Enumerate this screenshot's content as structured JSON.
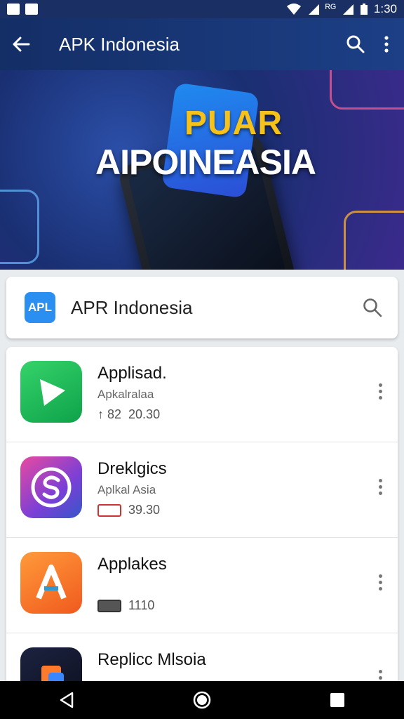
{
  "status_bar": {
    "time": "1:30",
    "signal": "ᴿᴳ"
  },
  "app_bar": {
    "title": "APK Indonesia"
  },
  "banner": {
    "line1": "PUAR",
    "line2": "AIPOINEASIA"
  },
  "search": {
    "logo_text": "APL",
    "query": "APR Indonesia"
  },
  "apps": [
    {
      "title": "Applisad.",
      "subtitle": "Apkalralaa",
      "meta_prefix": "↑ 82",
      "meta_value": "20.30"
    },
    {
      "title": "Dreklgics",
      "subtitle": "Aplkal Asia",
      "meta_prefix": "",
      "meta_value": "39.30"
    },
    {
      "title": "Applakes",
      "subtitle": "",
      "meta_prefix": "",
      "meta_value": "1110"
    },
    {
      "title": "Replicc Mlsoia",
      "subtitle": "",
      "meta_prefix": "",
      "meta_value": ""
    }
  ],
  "colors": {
    "appbar": "#1a3370",
    "accent": "#2a8ff0"
  }
}
